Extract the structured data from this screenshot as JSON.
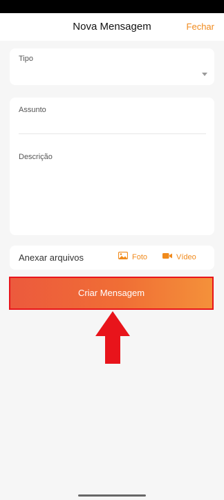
{
  "header": {
    "title": "Nova Mensagem",
    "close_label": "Fechar"
  },
  "tipo": {
    "label": "Tipo",
    "value": ""
  },
  "assunto": {
    "label": "Assunto",
    "value": ""
  },
  "descricao": {
    "label": "Descrição",
    "value": ""
  },
  "attachments": {
    "label": "Anexar arquivos",
    "foto_label": "Foto",
    "video_label": "Vídeo"
  },
  "submit": {
    "label": "Criar Mensagem"
  },
  "colors": {
    "accent": "#f08a1c",
    "button_gradient_start": "#ec5a3d",
    "button_gradient_end": "#f4913a",
    "highlight": "#e8141b"
  },
  "icons": {
    "foto": "image-icon",
    "video": "video-camera-icon",
    "dropdown": "chevron-down-icon",
    "annotation": "up-arrow-icon"
  }
}
